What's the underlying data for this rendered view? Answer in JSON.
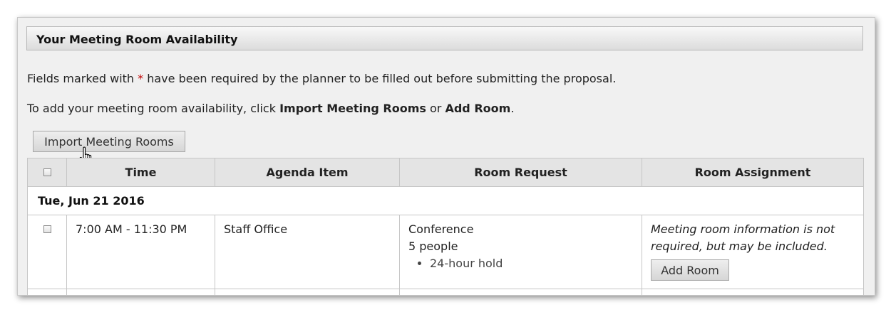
{
  "panel": {
    "title": "Your Meeting Room Availability"
  },
  "required_note": {
    "prefix": "Fields marked with ",
    "marker": "*",
    "suffix": " have been required by the planner to be filled out before submitting the proposal."
  },
  "instructions": {
    "prefix": "To add your meeting room availability, click ",
    "import_label": "Import Meeting Rooms",
    "middle": " or ",
    "add_label": "Add Room",
    "suffix": "."
  },
  "import_button": {
    "label": "Import Meeting Rooms"
  },
  "table": {
    "headers": [
      "Time",
      "Agenda Item",
      "Room Request",
      "Room Assignment"
    ],
    "date_group": "Tue, Jun 21 2016",
    "rows": [
      {
        "time": "7:00 AM - 11:30 PM",
        "agenda_item": "Staff Office",
        "room_type": "Conference",
        "people": "5 people",
        "details": [
          "24-hour hold"
        ],
        "assignment_note": "Meeting room information is not required, but may be included.",
        "add_room_label": "Add Room"
      }
    ]
  },
  "colors": {
    "required_marker": "#c00000",
    "header_bg": "#e4e4e4",
    "panel_bg": "#f0f0f0"
  }
}
